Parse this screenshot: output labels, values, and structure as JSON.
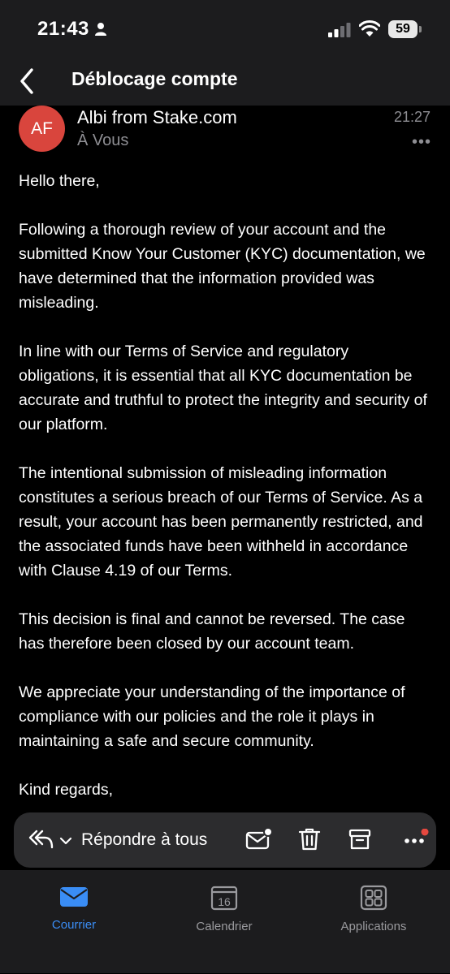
{
  "status_bar": {
    "time": "21:43",
    "battery": "59"
  },
  "header": {
    "title": "Déblocage compte"
  },
  "email": {
    "avatar_initials": "AF",
    "avatar_color": "#d9453d",
    "sender": "Albi from Stake.com",
    "recipient": "À Vous",
    "time": "21:27",
    "paragraphs": [
      "Hello there,",
      "Following a thorough review of your account and the submitted Know Your Customer (KYC) documentation, we have determined that the information provided was misleading.",
      "In line with our Terms of Service and regulatory obligations, it is essential that all KYC documentation be accurate and truthful to protect the integrity and security of our platform.",
      "The intentional submission of misleading information constitutes a serious breach of our Terms of Service. As a result, your account has been permanently restricted, and the associated funds have been withheld in accordance with Clause 4.19 of our Terms.",
      "This decision is final and cannot be reversed. The case has therefore been closed by our account team.",
      "We appreciate your understanding of the importance of compliance with our policies and the role it plays in maintaining a safe and secure community.",
      "Kind regards,"
    ]
  },
  "action_bar": {
    "reply_all_label": "Répondre à tous"
  },
  "tabs": [
    {
      "label": "Courrier",
      "icon": "mail-icon",
      "active": true
    },
    {
      "label": "Calendrier",
      "icon": "calendar-icon",
      "day": "16"
    },
    {
      "label": "Applications",
      "icon": "apps-icon"
    }
  ],
  "colors": {
    "accent": "#3a8df5",
    "notification_dot": "#e5483f"
  }
}
